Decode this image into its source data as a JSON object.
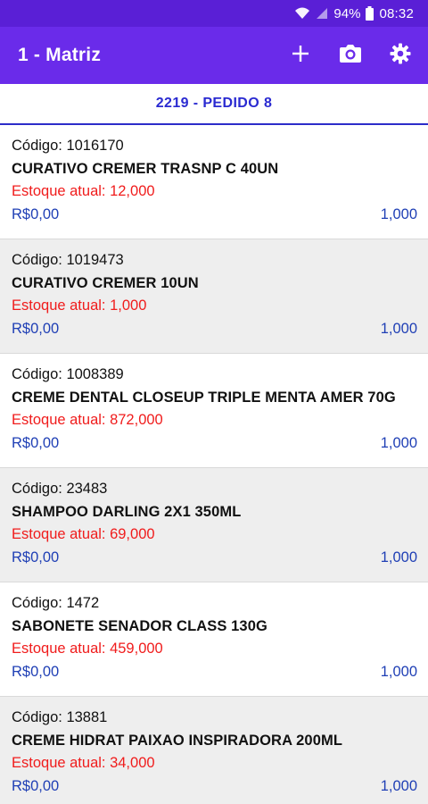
{
  "status_bar": {
    "battery": "94%",
    "time": "08:32"
  },
  "app_bar": {
    "title": "1 - Matriz",
    "icons": [
      "add-icon",
      "camera-icon",
      "settings-icon"
    ]
  },
  "subheader": {
    "label": "2219 - PEDIDO 8"
  },
  "items": [
    {
      "code": "Código: 1016170",
      "description": "CURATIVO CREMER TRASNP C 40UN",
      "stock": "Estoque atual: 12,000",
      "price": "R$0,00",
      "quantity": "1,000"
    },
    {
      "code": "Código: 1019473",
      "description": "CURATIVO CREMER  10UN",
      "stock": "Estoque atual: 1,000",
      "price": "R$0,00",
      "quantity": "1,000"
    },
    {
      "code": "Código: 1008389",
      "description": "CREME DENTAL CLOSEUP TRIPLE MENTA AMER 70G",
      "stock": "Estoque atual: 872,000",
      "price": "R$0,00",
      "quantity": "1,000"
    },
    {
      "code": "Código: 23483",
      "description": "SHAMPOO DARLING 2X1 350ML",
      "stock": "Estoque atual: 69,000",
      "price": "R$0,00",
      "quantity": "1,000"
    },
    {
      "code": "Código: 1472",
      "description": "SABONETE SENADOR CLASS 130G",
      "stock": "Estoque atual: 459,000",
      "price": "R$0,00",
      "quantity": "1,000"
    },
    {
      "code": "Código: 13881",
      "description": "CREME HIDRAT PAIXAO INSPIRADORA 200ML",
      "stock": "Estoque atual: 34,000",
      "price": "R$0,00",
      "quantity": "1,000"
    }
  ],
  "colors": {
    "primary": "#6a2bea",
    "status_bar": "#5a1fd6",
    "accent_blue": "#2a2ad1",
    "stock_red": "#f01c1c",
    "price_blue": "#1f3fb5",
    "alt_row": "#eeeeee"
  }
}
